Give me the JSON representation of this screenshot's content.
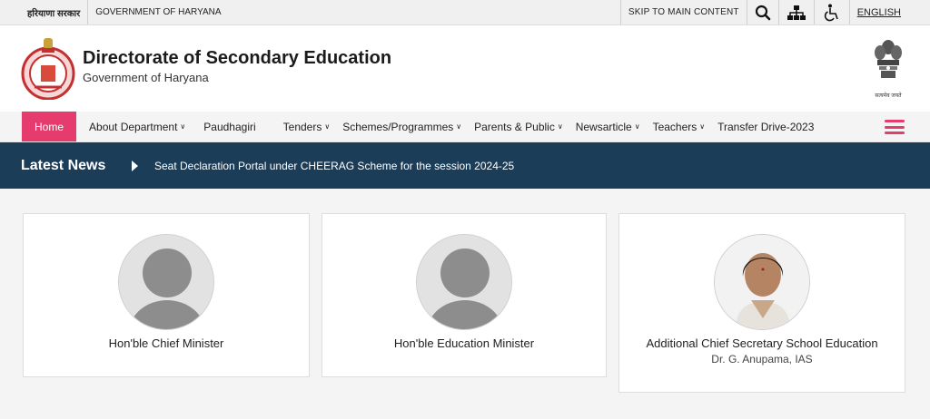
{
  "topbar": {
    "hindi_label": "हरियाणा सरकार",
    "gov_label": "GOVERNMENT OF HARYANA",
    "skip_label": "SKIP TO MAIN CONTENT",
    "language_label": "ENGLISH"
  },
  "header": {
    "title": "Directorate of Secondary Education",
    "subtitle": "Government of Haryana",
    "emblem_caption": "सत्यमेव जयते"
  },
  "nav": {
    "items": [
      {
        "label": "Home",
        "dropdown": false
      },
      {
        "label": "About Department",
        "dropdown": true
      },
      {
        "label": "Paudhagiri",
        "dropdown": false
      },
      {
        "label": "Tenders",
        "dropdown": true
      },
      {
        "label": "Schemes/Programmes",
        "dropdown": true
      },
      {
        "label": "Parents & Public",
        "dropdown": true
      },
      {
        "label": "Newsarticle",
        "dropdown": true
      },
      {
        "label": "Teachers",
        "dropdown": true
      },
      {
        "label": "Transfer Drive-2023",
        "dropdown": false
      }
    ]
  },
  "news": {
    "label": "Latest News",
    "headline": "Seat Declaration Portal under CHEERAG Scheme for the session 2024-25"
  },
  "cards": [
    {
      "title": "Hon'ble Chief Minister",
      "subtitle": "",
      "photo": "placeholder"
    },
    {
      "title": "Hon'ble Education Minister",
      "subtitle": "",
      "photo": "placeholder"
    },
    {
      "title": "Additional Chief Secretary School Education",
      "subtitle": "Dr. G. Anupama, IAS",
      "photo": "portrait"
    }
  ],
  "colors": {
    "accent": "#e63c6d",
    "news_bar": "#1c3d58"
  }
}
